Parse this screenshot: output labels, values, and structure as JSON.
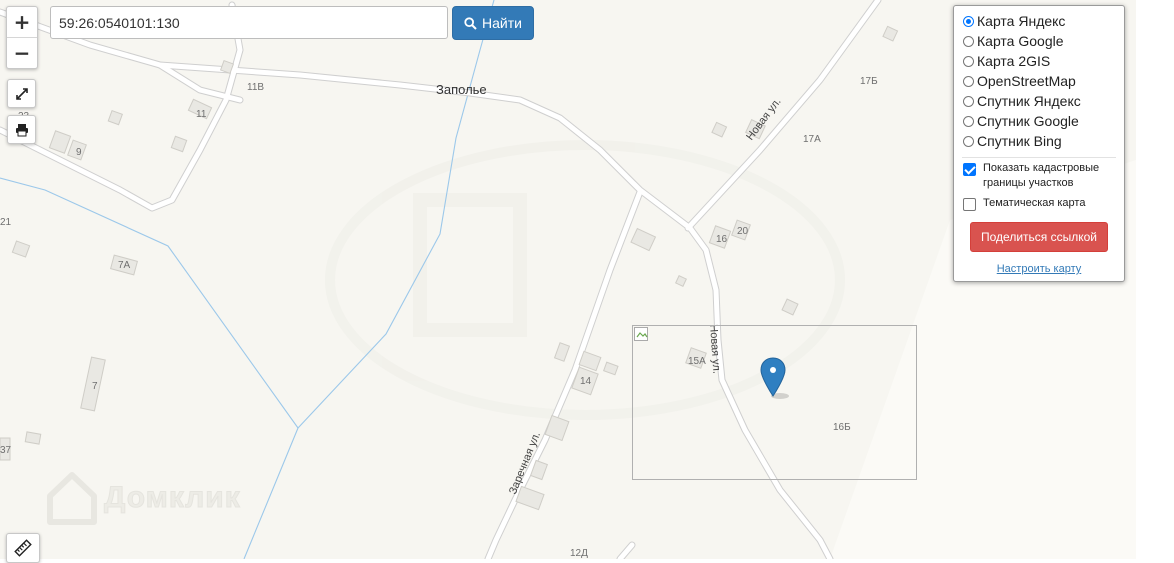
{
  "search": {
    "value": "59:26:0540101:130",
    "button_label": "Найти"
  },
  "zoom": {
    "in_label": "+",
    "out_label": "−"
  },
  "map_labels": {
    "place_zapolye": "Заполье",
    "street_novaya_1": "Новая ул.",
    "street_novaya_2": "Новая ул.",
    "street_zarechnaya": "Заречная ул.",
    "h_11v": "11В",
    "h_11": "11",
    "h_9": "9",
    "h_23": "23",
    "h_21": "21",
    "h_7a": "7А",
    "h_7": "7",
    "h_37": "37",
    "h_17b": "17Б",
    "h_17a": "17А",
    "h_16": "16",
    "h_20": "20",
    "h_15a": "15А",
    "h_16b": "16Б",
    "h_14": "14",
    "h_12d": "12Д"
  },
  "layers_panel": {
    "base_layers": [
      {
        "label": "Карта Яндекс",
        "selected": true
      },
      {
        "label": "Карта Google",
        "selected": false
      },
      {
        "label": "Карта 2GIS",
        "selected": false
      },
      {
        "label": "OpenStreetMap",
        "selected": false
      },
      {
        "label": "Спутник Яндекс",
        "selected": false
      },
      {
        "label": "Спутник Google",
        "selected": false
      },
      {
        "label": "Спутник Bing",
        "selected": false
      }
    ],
    "overlays": [
      {
        "label": "Показать кадастровые границы участков",
        "checked": true
      },
      {
        "label": "Тематическая карта",
        "checked": false
      }
    ],
    "share_button": "Поделиться ссылкой",
    "configure_link": "Настроить карту"
  },
  "watermark": "Домклик",
  "colors": {
    "map_bg": "#f7f6f1",
    "primary_button": "#337ab7",
    "danger_button": "#d9534f",
    "marker": "#2f7fc1",
    "river": "#9cc8ea"
  },
  "icons": {
    "fullscreen": "fullscreen-icon",
    "print": "print-icon",
    "search": "search-icon",
    "ruler": "ruler-icon",
    "marker": "map-marker-icon"
  }
}
